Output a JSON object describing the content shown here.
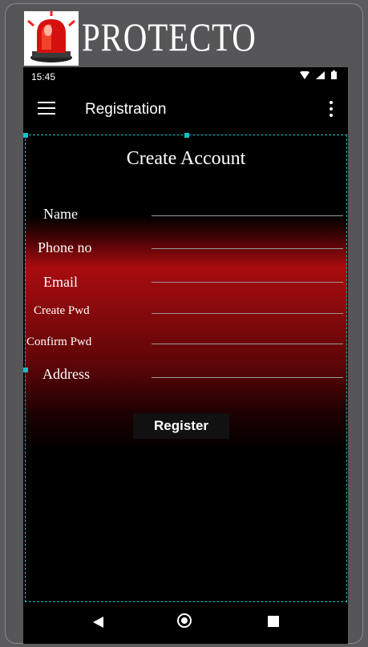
{
  "brand": {
    "title": "PROTECTO"
  },
  "status_bar": {
    "time": "15:45"
  },
  "app_bar": {
    "title": "Registration"
  },
  "form": {
    "title": "Create Account",
    "fields": [
      {
        "label": "Name",
        "value": ""
      },
      {
        "label": "Phone no",
        "value": ""
      },
      {
        "label": "Email",
        "value": ""
      },
      {
        "label": "Create Pwd",
        "value": ""
      },
      {
        "label": "Confirm Pwd",
        "value": ""
      },
      {
        "label": "Address",
        "value": ""
      }
    ],
    "register_label": "Register"
  },
  "colors": {
    "accent_red": "#a80c0f",
    "selection_outline": "#19bfc4",
    "background": "#000000"
  },
  "icons": [
    "siren-icon",
    "wifi-icon",
    "signal-icon",
    "battery-icon",
    "menu-icon",
    "more-vert-icon",
    "back-icon",
    "home-icon",
    "recents-icon"
  ]
}
